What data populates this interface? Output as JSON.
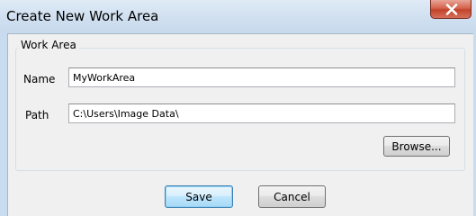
{
  "window": {
    "title": "Create New Work Area"
  },
  "group": {
    "legend": "Work Area"
  },
  "fields": {
    "name_label": "Name",
    "name_value": "MyWorkArea",
    "path_label": "Path",
    "path_value": "C:\\Users\\Image Data\\"
  },
  "buttons": {
    "browse": "Browse...",
    "save": "Save",
    "cancel": "Cancel"
  },
  "colors": {
    "titlebar": "#cfdff0",
    "client_background": "#f0f0f0",
    "close_button": "#c7432b",
    "default_button_border": "#3c7fb1"
  },
  "icons": {
    "close": "close-icon"
  }
}
